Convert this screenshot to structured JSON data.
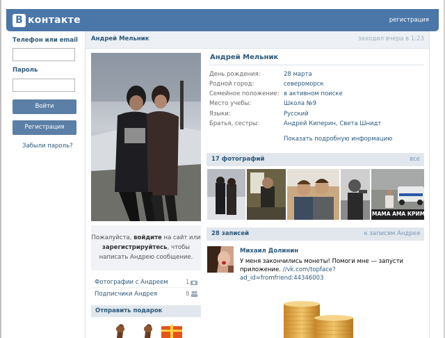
{
  "header": {
    "logo_mark": "В",
    "logo_text": "контакте",
    "register_link": "регистрация"
  },
  "login": {
    "phone_label": "Телефон или email",
    "password_label": "Пароль",
    "login_button": "Войти",
    "register_button": "Регистрация",
    "forgot_link": "Забыли пароль?"
  },
  "profile": {
    "name_header": "Андрей Мельник",
    "last_seen": "заходил вчера в 1:23",
    "name": "Андрей Мельник",
    "info": [
      {
        "key": "День рождения:",
        "value": "28 марта"
      },
      {
        "key": "Родной город:",
        "value": "североморск"
      },
      {
        "key": "Семейное положение:",
        "value": "в активном поиске"
      },
      {
        "key": "Место учебы:",
        "value": "Школа №9"
      },
      {
        "key": "Языки:",
        "value": "Русский"
      },
      {
        "key": "Братья, сестры:",
        "value": "Андрей Киперин, Света Шнидт"
      }
    ],
    "show_more": "Показать подробную информацию"
  },
  "message_box": {
    "line1_a": "Пожалуйста, ",
    "line1_b": "войдите",
    "line1_c": " на сайт или",
    "line2_a": "зарегистрируйтесь",
    "line2_b": ", чтобы",
    "line3": "написать Андрею сообщение."
  },
  "side_links": [
    {
      "label": "Фотографии с Андреем",
      "count": "1"
    },
    {
      "label": "Подписчики Андрея",
      "count": "8"
    }
  ],
  "gifts": {
    "title": "Отправить подарок"
  },
  "photos": {
    "title": "17 фотографий",
    "all_link": "все",
    "caption": "МАМА АМА КРИМИН"
  },
  "wall": {
    "title": "28 записей",
    "link": "к записям Андрея",
    "post": {
      "author": "Михаил Долинин",
      "text": "У меня закончились монеты! Помоги мне — запусти приложение. ",
      "link": "//vk.com/topface?ad_id=fromfriend:44346003"
    }
  },
  "colors": {
    "brand": "#4a76a8",
    "link": "#2b587a",
    "section_bg": "#e1e7ed"
  }
}
